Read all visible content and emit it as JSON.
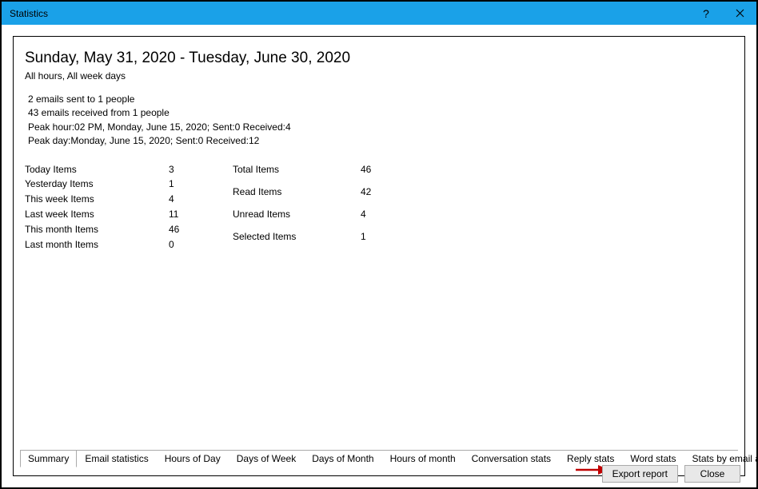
{
  "window": {
    "title": "Statistics"
  },
  "header": {
    "date_range": "Sunday, May 31, 2020 - Tuesday, June 30, 2020",
    "filter_text": "All hours, All week days"
  },
  "summary": {
    "sent": "2 emails sent to 1 people",
    "received": "43 emails received from 1 people",
    "peak_hour": "Peak hour:02 PM, Monday, June 15, 2020; Sent:0 Received:4",
    "peak_day": "Peak day:Monday, June 15, 2020; Sent:0 Received:12"
  },
  "stats_left": {
    "today_label": "Today Items",
    "today_val": "3",
    "yesterday_label": "Yesterday Items",
    "yesterday_val": "1",
    "this_week_label": "This week Items",
    "this_week_val": "4",
    "last_week_label": "Last week Items",
    "last_week_val": "11",
    "this_month_label": "This month Items",
    "this_month_val": "46",
    "last_month_label": "Last month Items",
    "last_month_val": "0"
  },
  "stats_right": {
    "total_label": "Total Items",
    "total_val": "46",
    "read_label": "Read Items",
    "read_val": "42",
    "unread_label": "Unread Items",
    "unread_val": "4",
    "selected_label": "Selected Items",
    "selected_val": "1"
  },
  "tabs": {
    "t0": "Summary",
    "t1": "Email statistics",
    "t2": "Hours of Day",
    "t3": "Days of Week",
    "t4": "Days of Month",
    "t5": "Hours of month",
    "t6": "Conversation stats",
    "t7": "Reply stats",
    "t8": "Word stats",
    "t9": "Stats by email address"
  },
  "buttons": {
    "export": "Export report",
    "close": "Close"
  }
}
